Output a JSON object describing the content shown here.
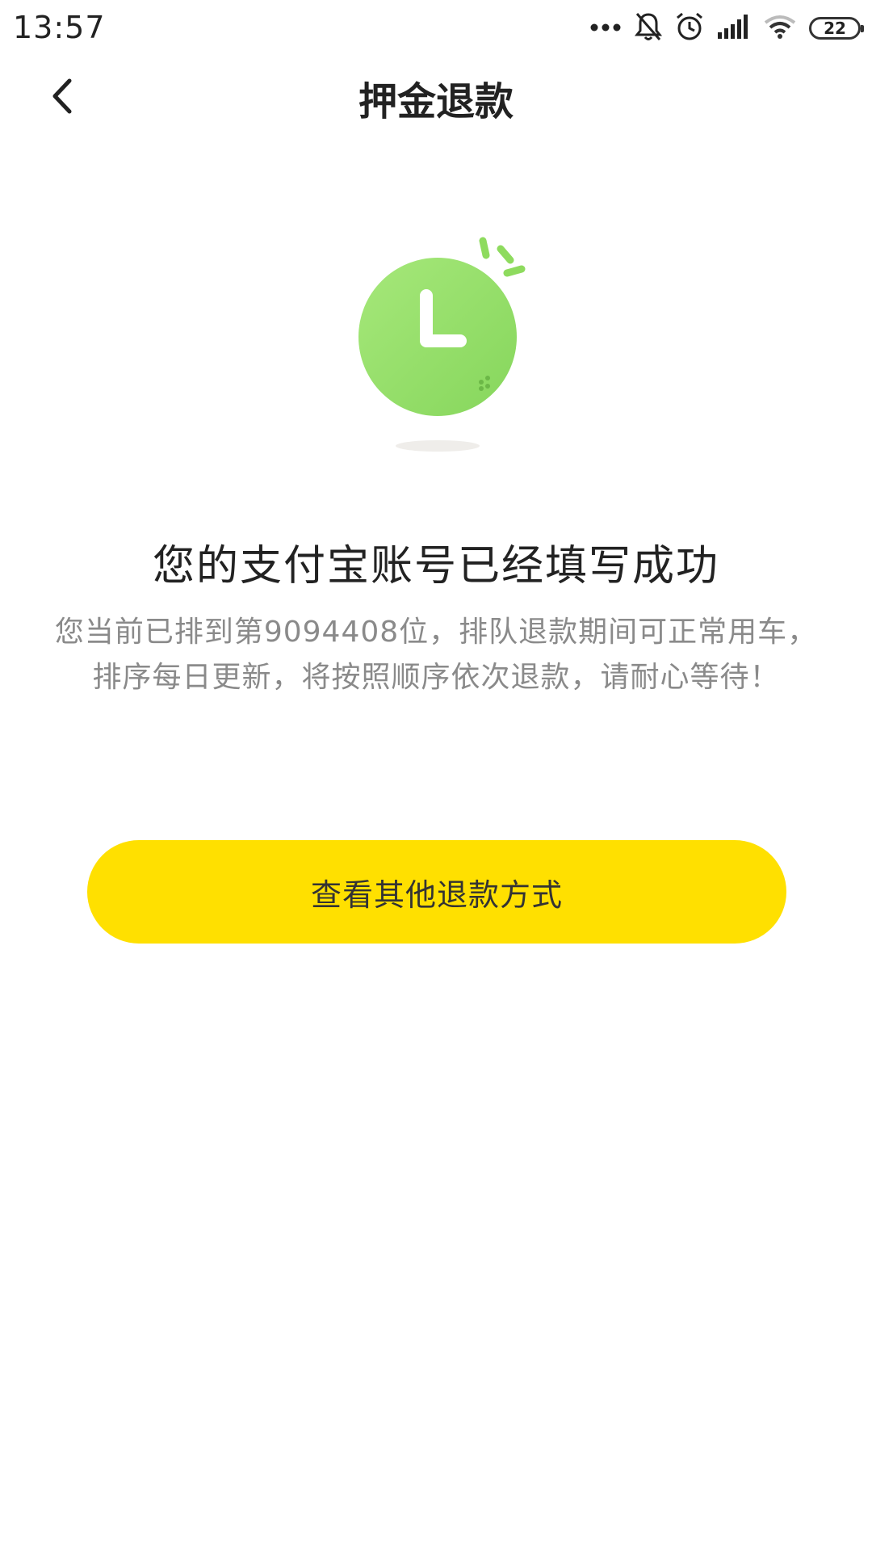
{
  "status_bar": {
    "time": "13:57",
    "battery": "22",
    "icons": [
      "more-dots-icon",
      "bell-off-icon",
      "alarm-icon",
      "signal-icon",
      "wifi-icon",
      "battery-icon"
    ]
  },
  "nav": {
    "title": "押金退款",
    "back_icon": "chevron-left-icon"
  },
  "illustration": {
    "icon": "clock-icon",
    "color": "#8EDB5E"
  },
  "result": {
    "title": "您的支付宝账号已经填写成功",
    "description": "您当前已排到第9094408位，排队退款期间可正常用车，排序每日更新，将按照顺序依次退款，请耐心等待！"
  },
  "actions": {
    "other_refund_label": "查看其他退款方式",
    "button_color": "#FFE000"
  }
}
